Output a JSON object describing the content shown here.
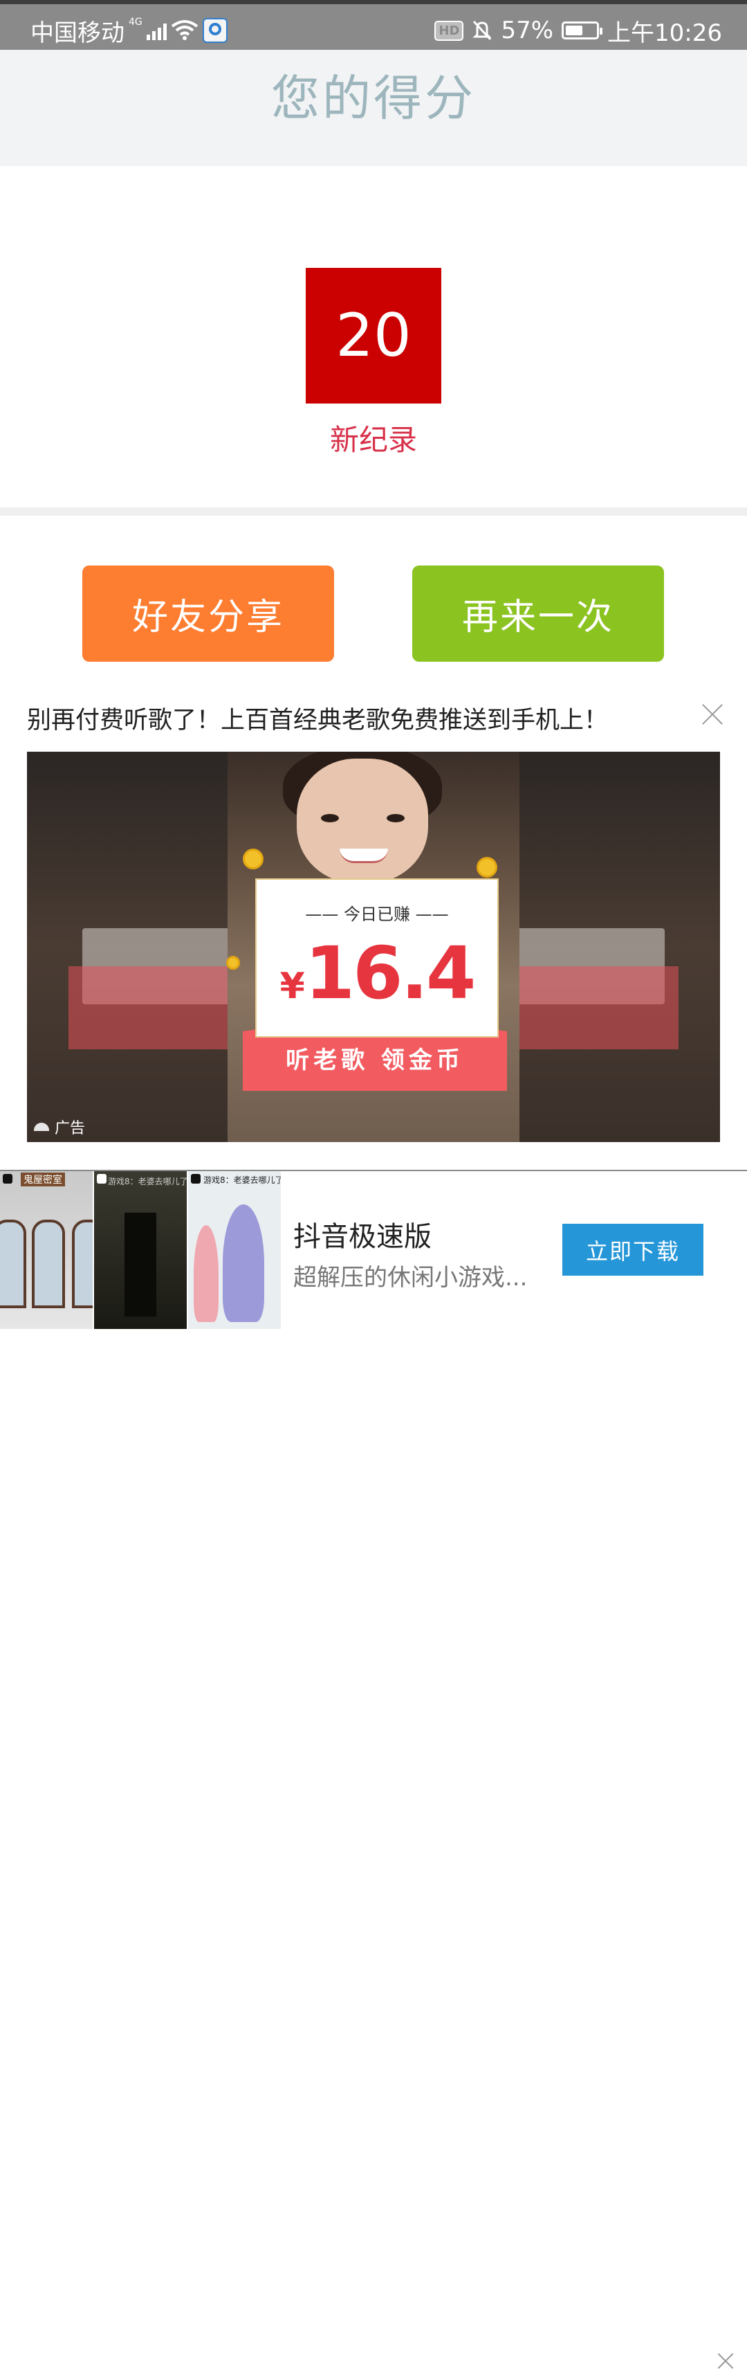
{
  "status_bar": {
    "carrier": "中国移动",
    "network": "4G",
    "hd_label": "HD",
    "battery": "57%",
    "battery_level": 0.57,
    "time": "上午10:26",
    "icons": [
      "signal-icon",
      "wifi-icon",
      "app-notification-icon",
      "hd-icon",
      "mute-icon",
      "battery-icon"
    ]
  },
  "header": {
    "title": "您的得分"
  },
  "score": {
    "value": "20",
    "record_label": "新纪录"
  },
  "actions": {
    "share_label": "好友分享",
    "retry_label": "再来一次"
  },
  "ad": {
    "headline": "别再付费听歌了！上百首经典老歌免费推送到手机上！",
    "card_subtitle": "—— 今日已赚 ——",
    "currency": "¥",
    "amount": "16.4",
    "card_cta": "听老歌 领金币",
    "tag": "广告"
  },
  "banner": {
    "thumbs": [
      {
        "caption": "鬼屋密室"
      },
      {
        "caption": "游戏8：老婆去哪儿了"
      },
      {
        "caption": "游戏8：老婆去哪儿了"
      }
    ],
    "title": "抖音极速版",
    "subtitle": "超解压的休闲小游戏...",
    "download_label": "立即下载"
  },
  "colors": {
    "status_bar": "#8a8a8a",
    "score_box": "#cb0000",
    "record_text": "#d8314a",
    "share_button": "#fd7d31",
    "retry_button": "#8bc321",
    "download_button": "#2596d8"
  }
}
